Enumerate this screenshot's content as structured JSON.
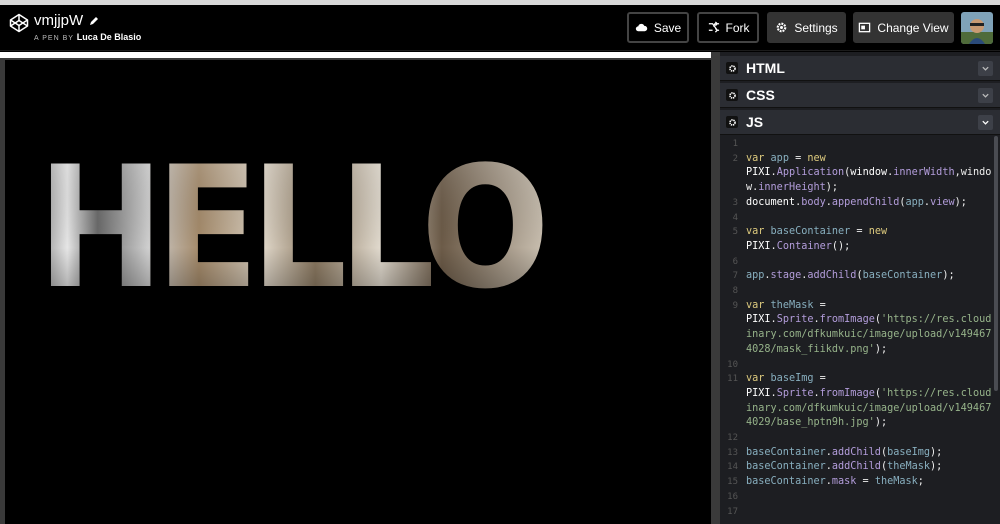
{
  "header": {
    "pen_title": "vmjjpW",
    "by_label": "A PEN BY",
    "author": "Luca De Blasio",
    "buttons": {
      "save": "Save",
      "fork": "Fork",
      "settings": "Settings",
      "change_view": "Change View"
    }
  },
  "preview": {
    "hello_text": "HELLO"
  },
  "editors": [
    {
      "title": "HTML",
      "collapsed": true
    },
    {
      "title": "CSS",
      "collapsed": true
    },
    {
      "title": "JS",
      "collapsed": false
    }
  ],
  "code_lines": [
    {
      "n": "1",
      "text": ""
    },
    {
      "n": "2",
      "text": "var app = new"
    },
    {
      "n": "",
      "text": "PIXI.Application(window.innerWidth,windo"
    },
    {
      "n": "",
      "text": "w.innerHeight);"
    },
    {
      "n": "3",
      "text": "document.body.appendChild(app.view);"
    },
    {
      "n": "4",
      "text": ""
    },
    {
      "n": "5",
      "text": "var baseContainer = new"
    },
    {
      "n": "",
      "text": "PIXI.Container();"
    },
    {
      "n": "6",
      "text": ""
    },
    {
      "n": "7",
      "text": "app.stage.addChild(baseContainer);"
    },
    {
      "n": "8",
      "text": ""
    },
    {
      "n": "9",
      "text": "var theMask ="
    },
    {
      "n": "",
      "text": "PIXI.Sprite.fromImage('https://res.cloud"
    },
    {
      "n": "",
      "text": "inary.com/dfkumkuic/image/upload/v149467"
    },
    {
      "n": "",
      "text": "4028/mask_fiikdv.png');"
    },
    {
      "n": "10",
      "text": ""
    },
    {
      "n": "11",
      "text": "var baseImg ="
    },
    {
      "n": "",
      "text": "PIXI.Sprite.fromImage('https://res.cloud"
    },
    {
      "n": "",
      "text": "inary.com/dfkumkuic/image/upload/v149467"
    },
    {
      "n": "",
      "text": "4029/base_hptn9h.jpg');"
    },
    {
      "n": "12",
      "text": ""
    },
    {
      "n": "13",
      "text": "baseContainer.addChild(baseImg);"
    },
    {
      "n": "14",
      "text": "baseContainer.addChild(theMask);"
    },
    {
      "n": "15",
      "text": "baseContainer.mask = theMask;"
    },
    {
      "n": "16",
      "text": ""
    },
    {
      "n": "17",
      "text": ""
    }
  ],
  "colors": {
    "keyword": "#ddca7e",
    "variable": "#88afbf",
    "function": "#b39ddb",
    "string": "#96b38a",
    "editor_bg": "#1d1e22",
    "editor_header": "#2b2d33"
  }
}
